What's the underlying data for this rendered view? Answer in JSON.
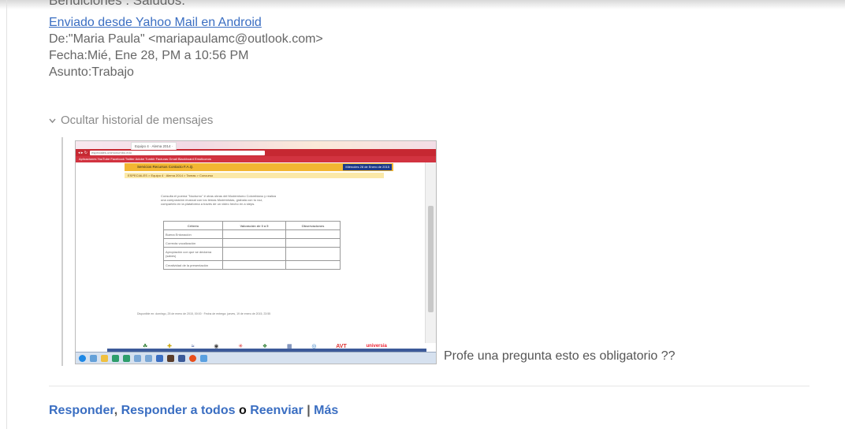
{
  "email": {
    "cutoff_text": "Bendiciones . Saludos.",
    "signature_link": "Enviado desde Yahoo Mail en Android",
    "from_line": "De:\"Maria Paula\" <mariapaulamc@outlook.com>",
    "date_line": "Fecha:Mié, Ene 28, PM a 10:56 PM",
    "subject_line": "Asunto:Trabajo",
    "history_toggle": "Ocultar historial de mensajes",
    "attachment_caption": "Profe una pregunta esto es obligatorio ??"
  },
  "embedded": {
    "tab1": "Equipo 4 · Alema 2014 ·",
    "url": "especiales.unimonumbo.edu",
    "bookmarks": "Aplicaciones  YouTube  Facebook  Twitter  Adobe  Tumblr  Facturas  Gmail  Blackboard  Emoticonos",
    "nav": "Servicios   Recursos   Contacto   F.A.Q.",
    "nav_date": "Miércoles 28 de Enero de 2015",
    "breadcrumb": "ESPECIALES > Equipo 4 · Alema 2014 > Tareas > Concurso",
    "intro": "Consulta el poema \"Nocturno\" # otras obras del Modernismo Colombiano y realiza una composición musical con los temas Modernistas, grabala con tu voz, compartelo en la plataforma a través de un video hecho en a steps.",
    "table_headers": [
      "Criterio",
      "Valoración de 0 a 5",
      "Observaciones"
    ],
    "table_rows": [
      "Buena Entonación",
      "Correcta vocalización",
      "Apropiación con que se declama (sabes)",
      "Creatividad de la presentación"
    ],
    "footer": "Disponible en: domingo, 25 de enero de 2015, 00:00 · Fecha de entrega: jueves, 19 de enero de 2015, 23:55",
    "logos": [
      "☘",
      "✚",
      "≈",
      "◉",
      "✳",
      "❖",
      "▦",
      "◎",
      "AVT",
      "universia"
    ]
  },
  "actions": {
    "reply": "Responder",
    "reply_all": "Responder a todos",
    "dot": "o",
    "forward": "Reenviar",
    "pipe": "|",
    "more": "Más",
    "comma": ","
  }
}
